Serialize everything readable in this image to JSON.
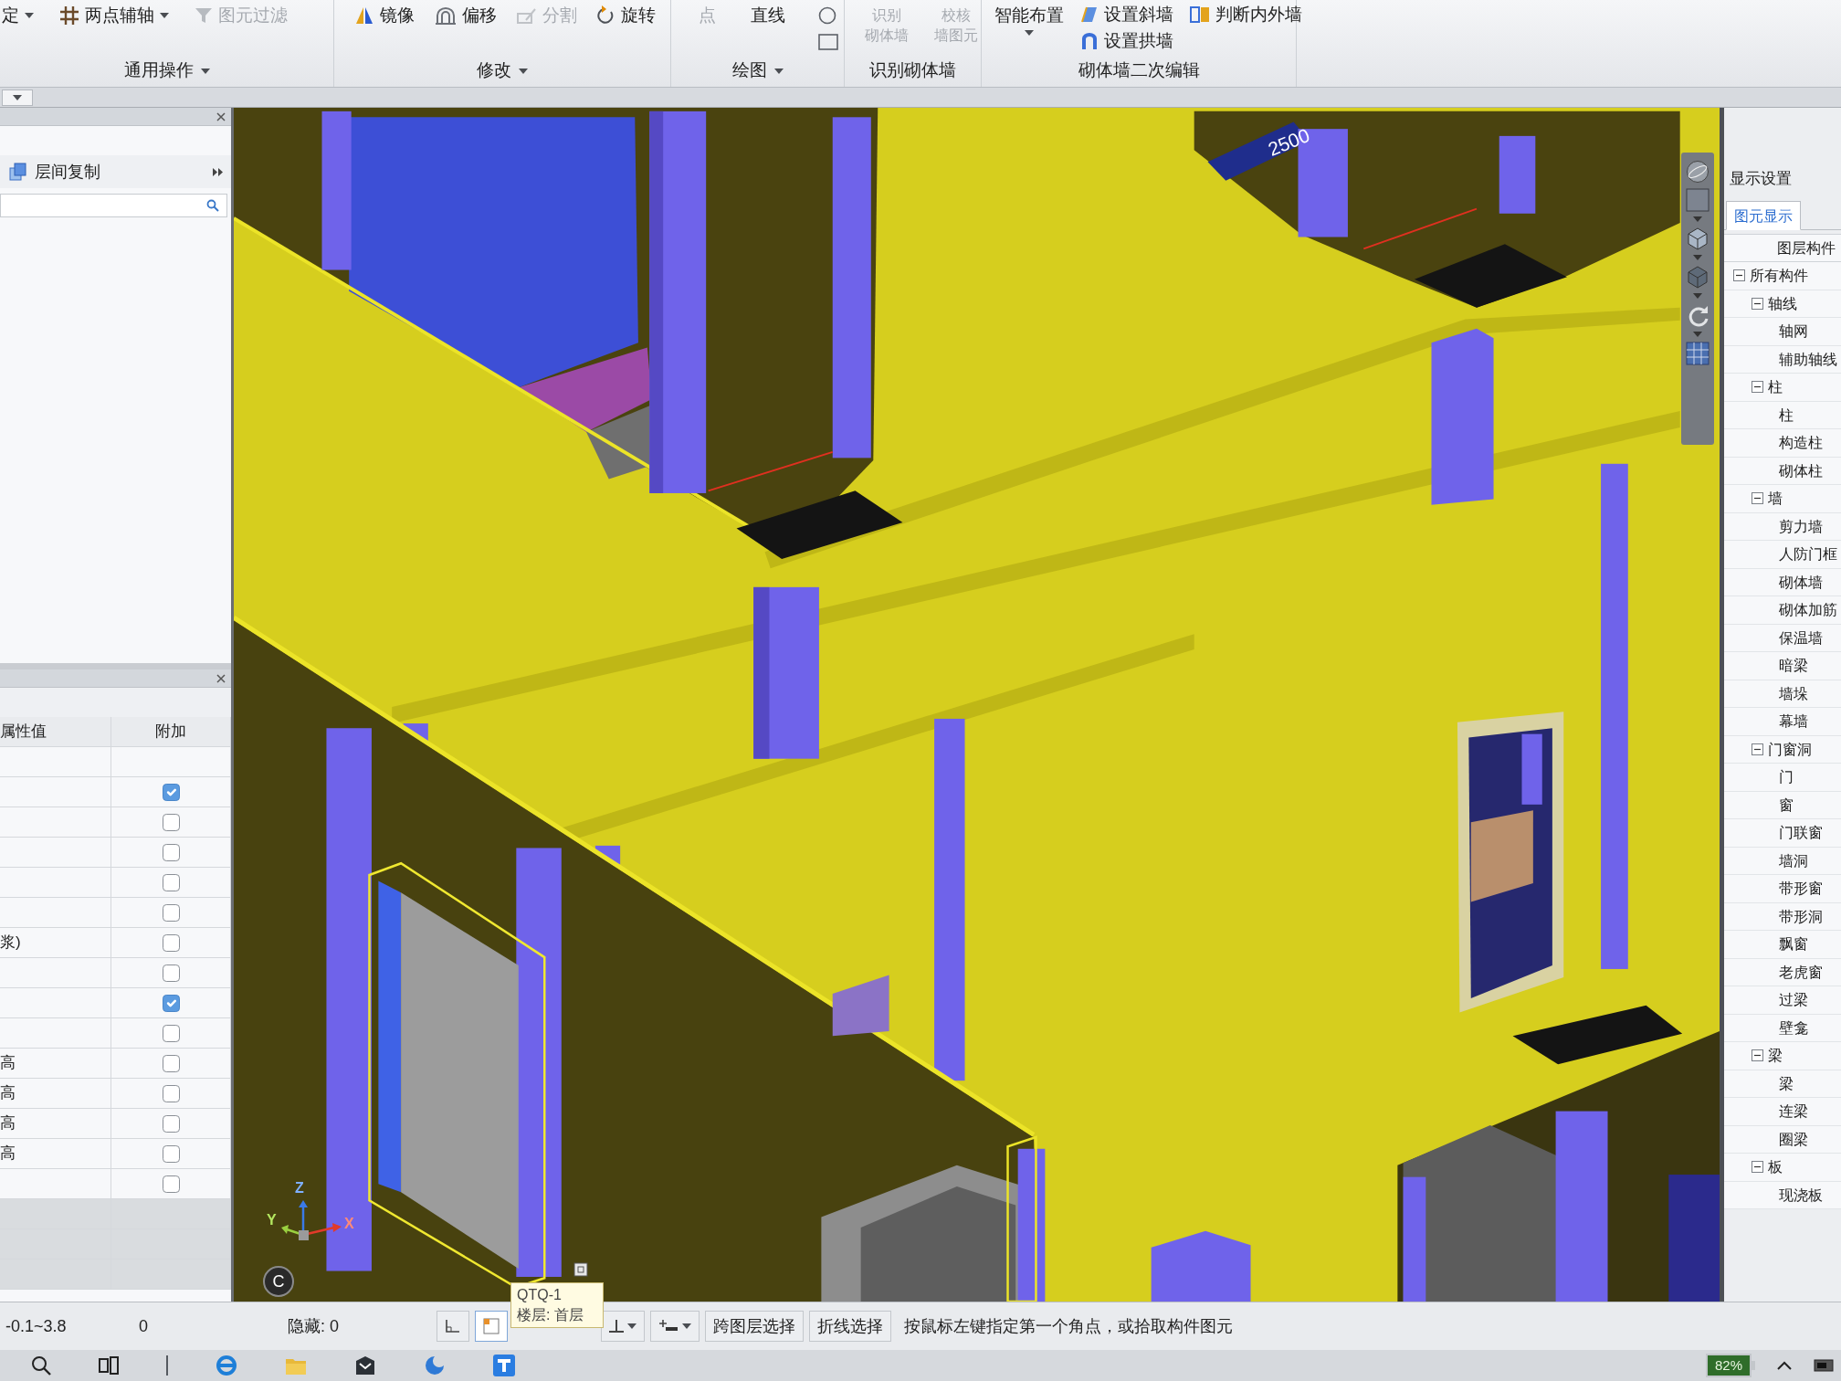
{
  "ribbon": {
    "groups": [
      {
        "label": "通用操作",
        "dropdown": true,
        "buttons": [
          {
            "kind": "tall",
            "label": "定",
            "disabled": false,
            "dropdown": true
          },
          {
            "kind": "tall",
            "label": "两点辅轴",
            "disabled": false,
            "dropdown": true
          },
          {
            "kind": "tall",
            "label": "图元过滤",
            "disabled": true
          }
        ]
      },
      {
        "label": "修改",
        "dropdown": true,
        "buttons": [
          {
            "kind": "tall",
            "label": "镜像",
            "disabled": false
          },
          {
            "kind": "tall",
            "label": "偏移",
            "disabled": false
          },
          {
            "kind": "tall",
            "label": "分割",
            "disabled": true
          },
          {
            "kind": "tall",
            "label": "旋转",
            "disabled": false
          }
        ]
      },
      {
        "label": "绘图",
        "dropdown": true,
        "buttons": [
          {
            "kind": "tall",
            "label": "点",
            "disabled": true
          },
          {
            "kind": "tall",
            "label": "直线",
            "disabled": false
          },
          {
            "kind": "icon",
            "disabled": false
          },
          {
            "kind": "icon",
            "disabled": false
          }
        ]
      },
      {
        "label": "识别砌体墙",
        "dropdown": false,
        "buttons": [
          {
            "kind": "tall",
            "lines": [
              "识别",
              "砌体墙"
            ],
            "disabled": true
          },
          {
            "kind": "tall",
            "lines": [
              "校核",
              "墙图元"
            ],
            "disabled": true
          }
        ]
      },
      {
        "label": "砌体墙二次编辑",
        "dropdown": false,
        "buttons": [
          {
            "kind": "big",
            "label": "智能布置",
            "disabled": false,
            "dropdown": true
          },
          {
            "kind": "cell",
            "label": "设置斜墙",
            "disabled": false
          },
          {
            "kind": "cell",
            "label": "设置拱墙",
            "disabled": false
          },
          {
            "kind": "cell",
            "label": "判断内外墙",
            "disabled": false
          }
        ]
      }
    ]
  },
  "left_panel": {
    "copy_button": "层间复制",
    "properties": {
      "columns": [
        "属性值",
        "附加"
      ],
      "rows": [
        {
          "kind": "blank"
        },
        {
          "kind": "check",
          "checked": true
        },
        {
          "kind": "check",
          "checked": false
        },
        {
          "kind": "check",
          "checked": false
        },
        {
          "kind": "check",
          "checked": false
        },
        {
          "kind": "check",
          "checked": false
        },
        {
          "kind": "check",
          "value": "浆)",
          "checked": false
        },
        {
          "kind": "check",
          "checked": false
        },
        {
          "kind": "check",
          "checked": true
        },
        {
          "kind": "check",
          "checked": false
        },
        {
          "kind": "check",
          "value": "高",
          "checked": false
        },
        {
          "kind": "check",
          "value": "高",
          "checked": false
        },
        {
          "kind": "check",
          "value": "高",
          "checked": false
        },
        {
          "kind": "check",
          "value": "高",
          "checked": false
        },
        {
          "kind": "check",
          "checked": false
        },
        {
          "kind": "group"
        },
        {
          "kind": "group"
        },
        {
          "kind": "group"
        }
      ]
    }
  },
  "viewport": {
    "dimension_label": "2500",
    "compass_label": "C",
    "axis_labels": [
      "X",
      "Y",
      "Z"
    ]
  },
  "tooltip": {
    "lines": [
      "QTQ-1",
      "楼层: 首层"
    ]
  },
  "display_settings": {
    "title": "显示设置",
    "tabs": [
      {
        "label": "图元显示",
        "selected": true
      }
    ],
    "tree_header": "图层构件",
    "tree": [
      {
        "label": "所有构件",
        "expanded": true,
        "children": [
          {
            "label": "轴线",
            "expanded": true,
            "children": [
              {
                "label": "轴网"
              },
              {
                "label": "辅助轴线"
              }
            ]
          },
          {
            "label": "柱",
            "expanded": true,
            "children": [
              {
                "label": "柱"
              },
              {
                "label": "构造柱"
              },
              {
                "label": "砌体柱"
              }
            ]
          },
          {
            "label": "墙",
            "expanded": true,
            "children": [
              {
                "label": "剪力墙"
              },
              {
                "label": "人防门框"
              },
              {
                "label": "砌体墙"
              },
              {
                "label": "砌体加筋"
              },
              {
                "label": "保温墙"
              },
              {
                "label": "暗梁"
              },
              {
                "label": "墙垛"
              },
              {
                "label": "幕墙"
              }
            ]
          },
          {
            "label": "门窗洞",
            "expanded": true,
            "children": [
              {
                "label": "门"
              },
              {
                "label": "窗"
              },
              {
                "label": "门联窗"
              },
              {
                "label": "墙洞"
              },
              {
                "label": "带形窗"
              },
              {
                "label": "带形洞"
              },
              {
                "label": "飘窗"
              },
              {
                "label": "老虎窗"
              },
              {
                "label": "过梁"
              },
              {
                "label": "壁龛"
              }
            ]
          },
          {
            "label": "梁",
            "expanded": true,
            "children": [
              {
                "label": "梁"
              },
              {
                "label": "连梁"
              },
              {
                "label": "圈梁"
              }
            ]
          },
          {
            "label": "板",
            "expanded": true,
            "children": [
              {
                "label": "现浇板"
              }
            ]
          }
        ]
      }
    ]
  },
  "status_bar": {
    "elevation": "-0.1~3.8",
    "count": "0",
    "hidden": "隐藏: 0",
    "tools": [
      {
        "kind": "icon",
        "selected": false
      },
      {
        "kind": "icon",
        "selected": true
      },
      {
        "kind": "icon_dropdown",
        "selected": false
      },
      {
        "kind": "icon_dropdown",
        "selected": false
      },
      {
        "kind": "text",
        "label": "跨图层选择",
        "selected": false
      },
      {
        "kind": "text",
        "label": "折线选择",
        "selected": false
      }
    ],
    "hint": "按鼠标左键指定第一个角点，或拾取构件图元"
  },
  "taskbar": {
    "battery": "82%"
  }
}
